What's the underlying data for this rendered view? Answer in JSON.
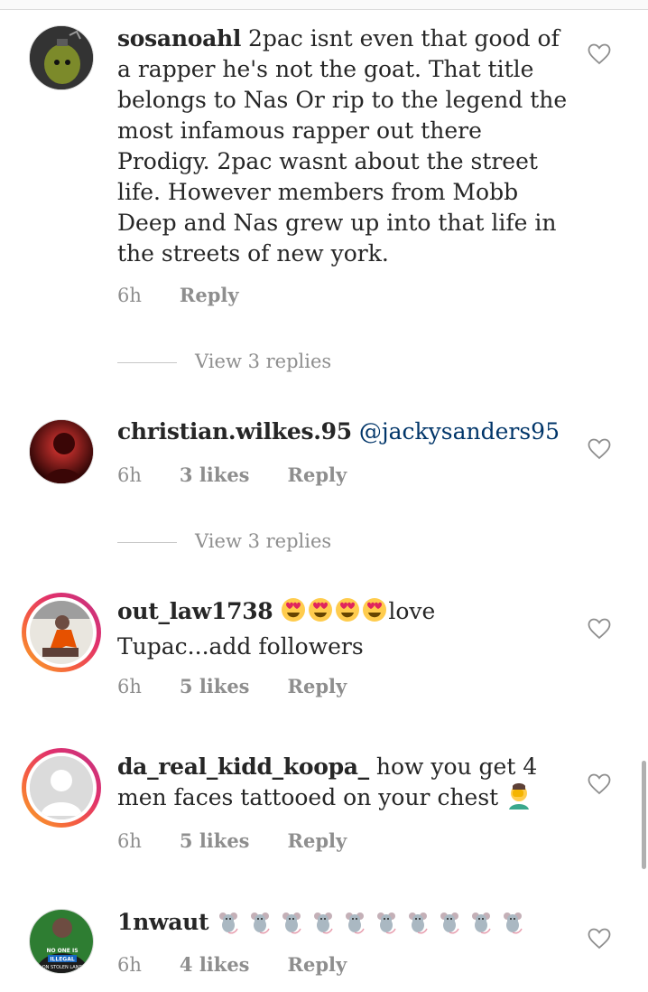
{
  "comments": [
    {
      "username": "sosanoahl",
      "text": " 2pac isnt even that good of a rapper he's not the goat. That title belongs to Nas Or rip to the legend the most infamous rapper out there Prodigy. 2pac wasnt about the street life. However members from Mobb Deep and Nas grew up into that life in the streets of new york.",
      "time": "6h",
      "reply": "Reply",
      "view_replies": "View 3 replies"
    },
    {
      "username": "christian.wilkes.95",
      "mention": " @jackysanders95",
      "time": "6h",
      "likes": "3 likes",
      "reply": "Reply",
      "view_replies": "View 3 replies"
    },
    {
      "username": "out_law1738",
      "text_after": "love Tupac...add followers",
      "emoji": "smiling-heart-eyes",
      "time": "6h",
      "likes": "5 likes",
      "reply": "Reply"
    },
    {
      "username": "da_real_kidd_koopa_",
      "text": " how you get 4 men faces tattooed on your chest",
      "emoji": "facepalm",
      "time": "6h",
      "likes": "5 likes",
      "reply": "Reply"
    },
    {
      "username": "1nwaut",
      "emoji": "rat",
      "time": "6h",
      "likes": "4 likes",
      "reply": "Reply"
    }
  ],
  "avatar_text": {
    "c5": [
      "NO ONE IS",
      "ILLEGAL",
      "ON STOLEN LAND"
    ]
  },
  "colors": {
    "meta": "#8e8e8e",
    "mention": "#003569",
    "text": "#262626"
  }
}
